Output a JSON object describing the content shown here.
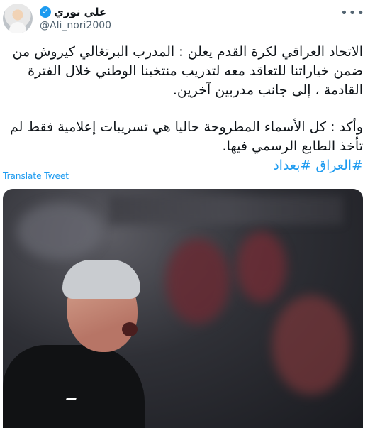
{
  "tweet": {
    "author": {
      "display_name": "علي نوري",
      "handle": "@Ali_nori2000",
      "verified": true
    },
    "more_icon": "more-dots-icon",
    "paragraph1": "الاتحاد العراقي لكرة القدم يعلن : المدرب البرتغالي كيروش من ضمن خياراتنا للتعاقد معه لتدريب منتخبنا الوطني خلال الفترة القادمة ، إلى جانب مدربين آخرين.",
    "paragraph2": "وأكد : كل الأسماء المطروحة حاليا هي تسريبات إعلامية فقط لم تأخذ الطابع الرسمي فيها.",
    "hashtags": "#العراق #بغداد",
    "translate_label": "Translate Tweet"
  },
  "colors": {
    "link": "#1d9bf0",
    "text": "#0f1419",
    "secondary": "#536471"
  }
}
